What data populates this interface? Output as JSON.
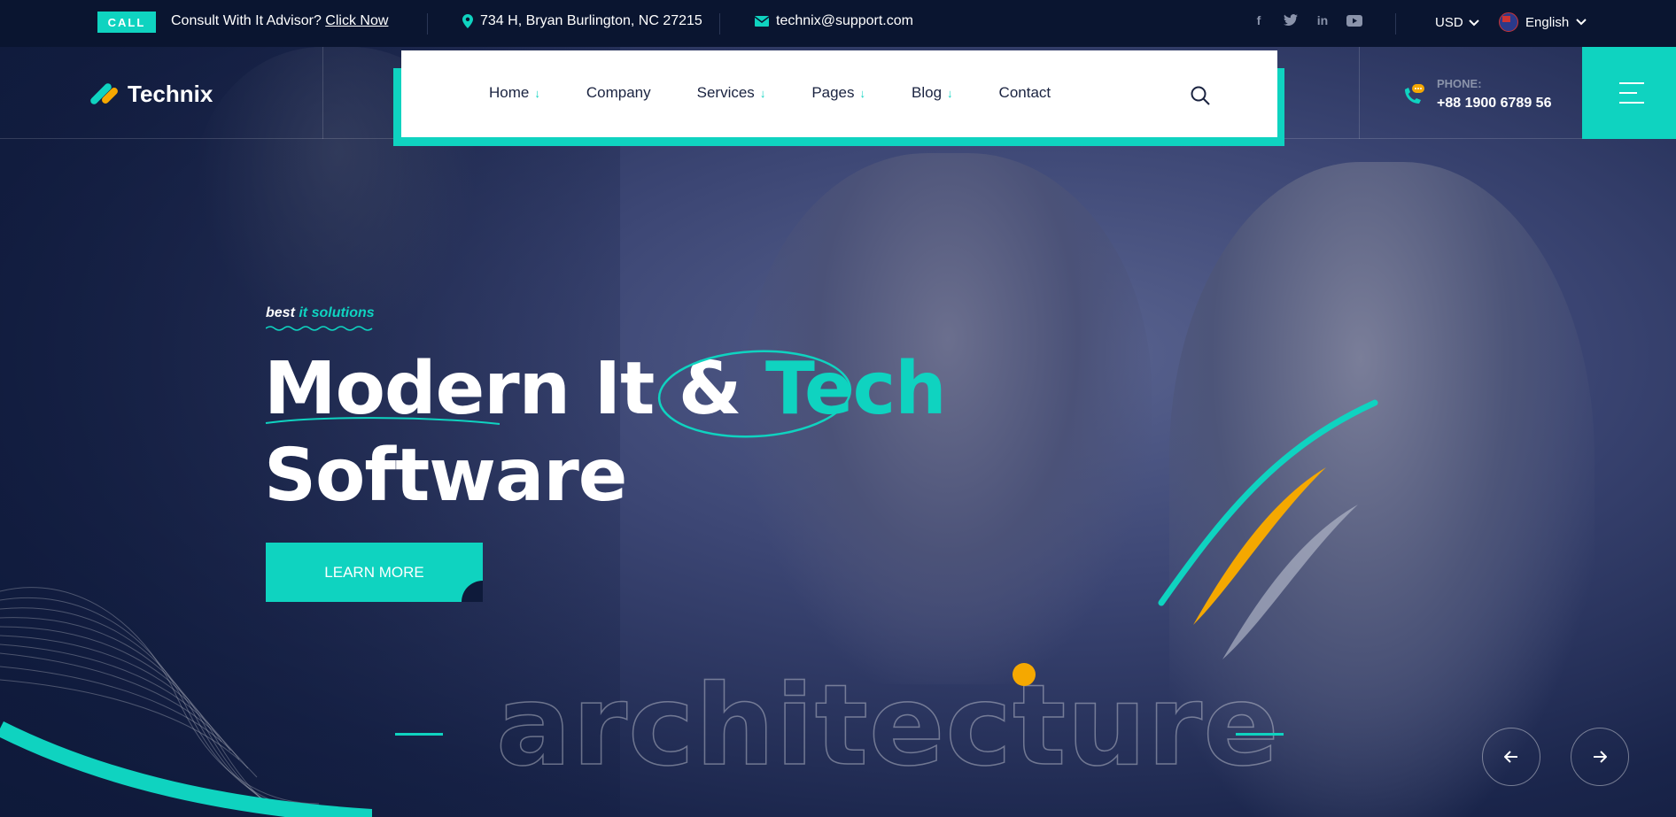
{
  "topbar": {
    "call_badge": "CALL",
    "consult_text": "Consult With It Advisor?",
    "consult_link": "Click Now",
    "address": "734 H, Bryan Burlington, NC 27215",
    "email": "technix@support.com",
    "social_icons": [
      "facebook-icon",
      "twitter-icon",
      "linkedin-icon",
      "youtube-icon"
    ],
    "currency": "USD",
    "language": "English"
  },
  "header": {
    "logo_text": "Technix",
    "nav": [
      {
        "label": "Home",
        "has_dropdown": true
      },
      {
        "label": "Company",
        "has_dropdown": false
      },
      {
        "label": "Services",
        "has_dropdown": true
      },
      {
        "label": "Pages",
        "has_dropdown": true
      },
      {
        "label": "Blog",
        "has_dropdown": true
      },
      {
        "label": "Contact",
        "has_dropdown": false
      }
    ],
    "phone_label": "PHONE:",
    "phone_number": "+88 1900 6789 56"
  },
  "hero": {
    "sub_a": "best",
    "sub_b": "it solutions",
    "title_part1": "Modern It &",
    "title_highlight": "Tech",
    "title_line2": "Software",
    "cta_label": "LEARN MORE",
    "outline_word": "architecture"
  },
  "colors": {
    "accent": "#0fd3c0",
    "yellow": "#f5a800",
    "topbar_bg": "#0a1530",
    "hero_bg": "#0e1a3a"
  }
}
